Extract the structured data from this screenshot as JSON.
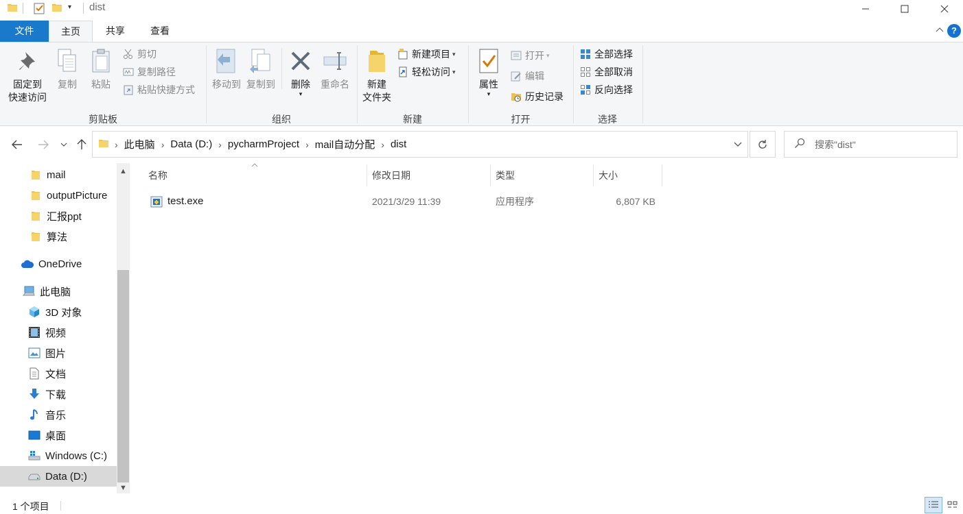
{
  "window": {
    "title": "dist"
  },
  "ribbon": {
    "tabs": [
      "文件",
      "主页",
      "共享",
      "查看"
    ],
    "clipboard": {
      "pin_line1": "固定到",
      "pin_line2": "快速访问",
      "copy": "复制",
      "paste": "粘贴",
      "cut": "剪切",
      "copy_path": "复制路径",
      "paste_shortcut": "粘贴快捷方式",
      "label": "剪贴板"
    },
    "organize": {
      "move_to": "移动到",
      "copy_to": "复制到",
      "delete": "删除",
      "rename": "重命名",
      "label": "组织"
    },
    "new": {
      "new_folder_line1": "新建",
      "new_folder_line2": "文件夹",
      "new_item": "新建项目",
      "easy_access": "轻松访问",
      "label": "新建"
    },
    "open": {
      "properties": "属性",
      "open": "打开",
      "edit": "编辑",
      "history": "历史记录",
      "label": "打开"
    },
    "select": {
      "select_all": "全部选择",
      "select_none": "全部取消",
      "invert": "反向选择",
      "label": "选择"
    }
  },
  "address": {
    "breadcrumbs": [
      "此电脑",
      "Data (D:)",
      "pycharmProject",
      "mail自动分配",
      "dist"
    ]
  },
  "search": {
    "placeholder": "搜索\"dist\""
  },
  "nav": {
    "items": [
      "mail",
      "outputPicture",
      "汇报ppt",
      "算法",
      "OneDrive",
      "此电脑",
      "3D 对象",
      "视频",
      "图片",
      "文档",
      "下载",
      "音乐",
      "桌面",
      "Windows (C:)",
      "Data (D:)"
    ]
  },
  "columns": {
    "name": "名称",
    "modified": "修改日期",
    "type": "类型",
    "size": "大小"
  },
  "files": [
    {
      "name": "test.exe",
      "modified": "2021/3/29 11:39",
      "type": "应用程序",
      "size": "6,807 KB"
    }
  ],
  "status": {
    "count": "1 个项目"
  },
  "colors": {
    "file_tab": "#1979ca",
    "ribbon_bg": "#f5f6f7",
    "selected_nav": "#d9d9d9",
    "folder": "#f0c14b"
  }
}
